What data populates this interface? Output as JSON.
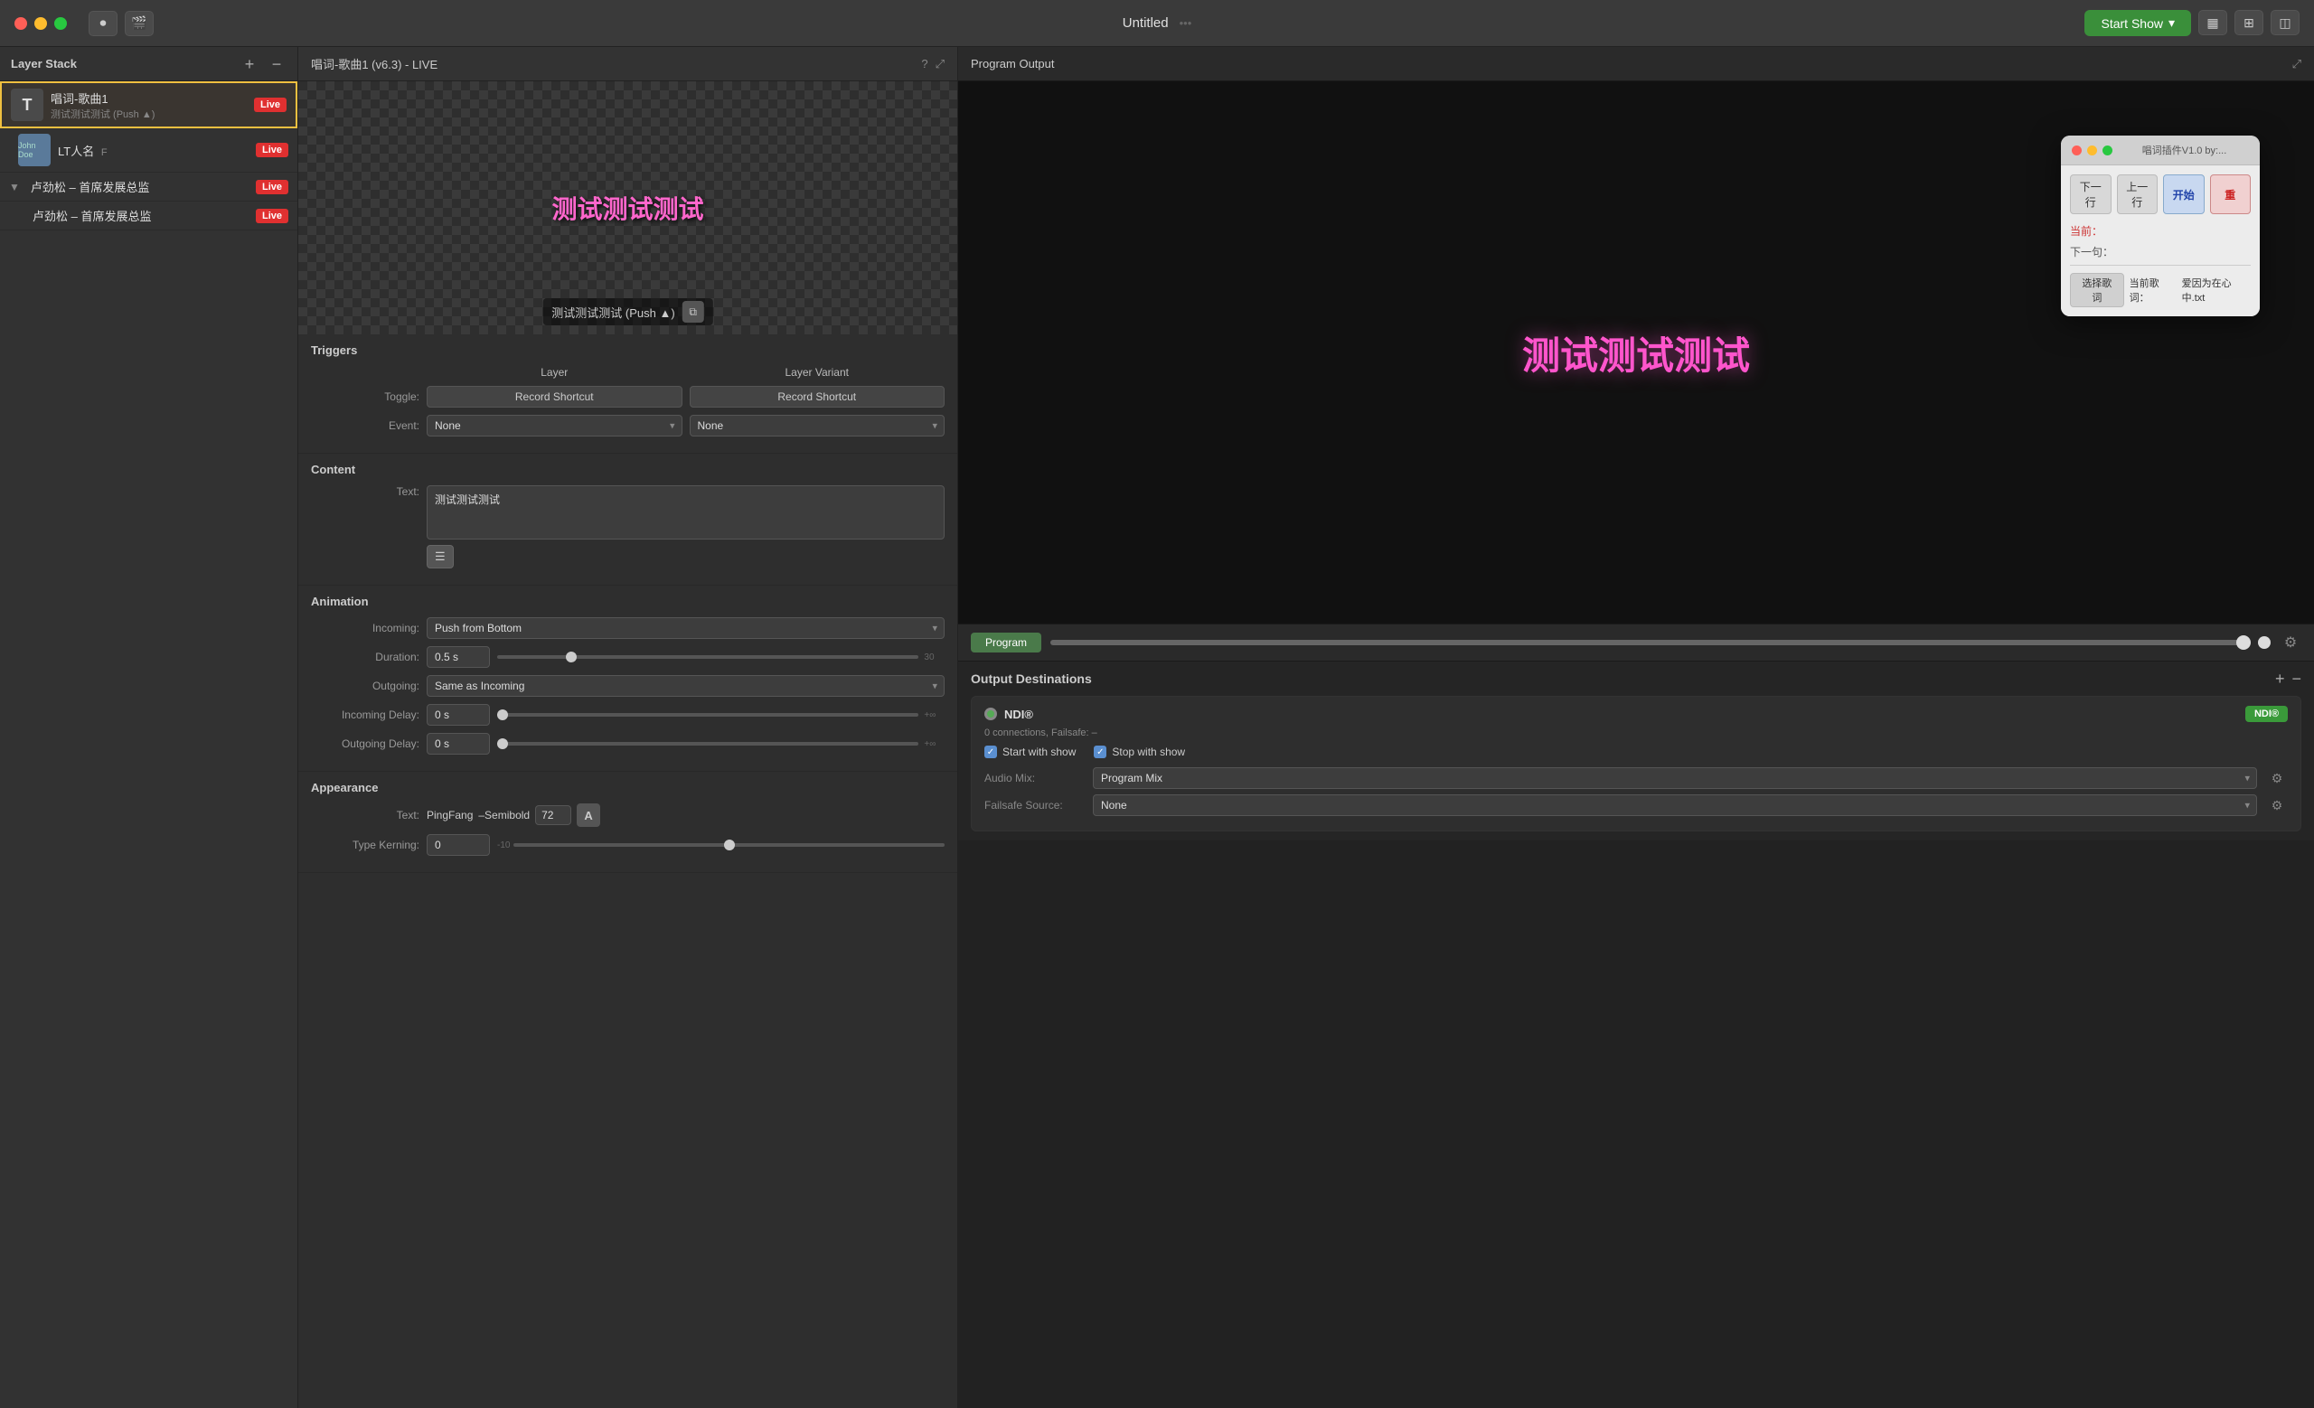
{
  "titlebar": {
    "title": "Untitled",
    "start_show_label": "Start Show",
    "dropdown_arrow": "▾"
  },
  "left_panel": {
    "title": "Layer Stack",
    "add_btn": "+",
    "remove_btn": "−",
    "layers": [
      {
        "icon": "T",
        "name": "唱词-歌曲1",
        "sub": "测试测试测试 (Push ▲)",
        "badge": "Live",
        "active": true
      },
      {
        "icon": "LT",
        "name": "LT人名",
        "sub": "",
        "badge": "Live",
        "avatar_text": "John Doe",
        "flag": "F"
      },
      {
        "icon": "",
        "name": "卢劲松 – 首席发展总监",
        "sub": "",
        "badge": "Live",
        "indent": true,
        "has_arrow": true
      },
      {
        "icon": "",
        "name": "卢劲松 – 首席发展总监",
        "sub": "",
        "badge": "Live",
        "indent2": true
      }
    ]
  },
  "center_panel": {
    "title": "唱词-歌曲1 (v6.3) - LIVE",
    "preview_text": "测试测试测试",
    "variant_label": "测试测试测试 (Push ▲)",
    "triggers": {
      "title": "Triggers",
      "col_layer": "Layer",
      "col_variant": "Layer Variant",
      "toggle_label": "Toggle:",
      "event_label": "Event:",
      "record_shortcut": "Record Shortcut",
      "none_option": "None"
    },
    "content": {
      "title": "Content",
      "text_label": "Text:",
      "text_value": "测试测试测试"
    },
    "animation": {
      "title": "Animation",
      "incoming_label": "Incoming:",
      "incoming_value": "Push from Bottom",
      "duration_label": "Duration:",
      "duration_value": "0.5 s",
      "slider_max": "30",
      "outgoing_label": "Outgoing:",
      "outgoing_value": "Same as Incoming",
      "incoming_delay_label": "Incoming Delay:",
      "incoming_delay_value": "0 s",
      "outgoing_delay_label": "Outgoing Delay:",
      "outgoing_delay_value": "0 s"
    },
    "appearance": {
      "title": "Appearance",
      "text_label": "Text:",
      "font_name": "PingFang",
      "font_weight": "–Semibold",
      "font_size": "72",
      "type_kerning_label": "Type Kerning:",
      "type_kerning_value": "0",
      "slider_neg": "-10"
    }
  },
  "right_panel": {
    "title": "Program Output",
    "program_text": "测试测试测试",
    "program_tab_label": "Program",
    "gear_icon": "⚙"
  },
  "plugin_window": {
    "title": "唱词插件V1.0 by:...",
    "btn_prev": "下一行",
    "btn_next": "上一行",
    "btn_start": "开始",
    "btn_reset": "重",
    "current_label": "当前：",
    "current_value": "",
    "next_label": "下一句：",
    "next_value": "",
    "select_lyrics_label": "选择歌词",
    "current_song_label": "当前歌词：",
    "current_song_value": "爱因为在心中.txt"
  },
  "output_destinations": {
    "title": "Output Destinations",
    "ndi": {
      "title": "NDI®",
      "subtitle": "0 connections, Failsafe: –",
      "badge": "NDI®",
      "start_with_show": "Start with show",
      "stop_with_show": "Stop with show",
      "audio_mix_label": "Audio Mix:",
      "audio_mix_value": "Program Mix",
      "failsafe_label": "Failsafe Source:",
      "failsafe_value": "None",
      "audio_mix_options": [
        "Program Mix"
      ],
      "failsafe_options": [
        "None"
      ]
    }
  }
}
